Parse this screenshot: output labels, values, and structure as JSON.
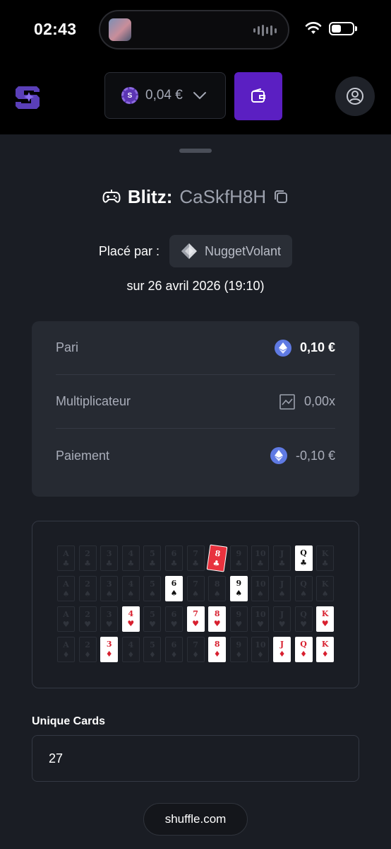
{
  "status_bar": {
    "time": "02:43",
    "battery_level": 0.45,
    "icons": [
      "now-playing-thumbnail",
      "audio-waveform-icon",
      "wifi-icon",
      "battery-icon"
    ]
  },
  "header": {
    "logo_icon": "shuffle-logo-icon",
    "balance": "0,04 €",
    "currency_icon": "shuffle-coin-icon",
    "wallet_icon": "wallet-icon",
    "profile_icon": "user-icon",
    "accent_color": "#5b1fc2"
  },
  "bet": {
    "game": "Blitz:",
    "game_icon": "gamepad-icon",
    "bet_id": "CaSkfH8H",
    "copy_icon": "copy-icon",
    "placed_by_label": "Placé par :",
    "user": "NuggetVolant",
    "user_icon": "diamond-rank-icon",
    "date": "sur 26 avril 2026 (19:10)"
  },
  "stats": [
    {
      "label": "Pari",
      "value": "0,10 €",
      "icon": "ethereum-icon"
    },
    {
      "label": "Multiplicateur",
      "value": "0,00x",
      "icon": "chart-icon"
    },
    {
      "label": "Paiement",
      "value": "-0,10 €",
      "icon": "ethereum-icon"
    }
  ],
  "card_grid": {
    "ranks": [
      "A",
      "2",
      "3",
      "4",
      "5",
      "6",
      "7",
      "8",
      "9",
      "10",
      "J",
      "Q",
      "K"
    ],
    "rows": [
      {
        "suit": "♣",
        "red": false,
        "shown": [
          "8",
          "Q"
        ],
        "highlight": "8"
      },
      {
        "suit": "♠",
        "red": false,
        "shown": [
          "6",
          "9"
        ],
        "highlight": ""
      },
      {
        "suit": "♥",
        "red": true,
        "shown": [
          "4",
          "7",
          "8",
          "K"
        ],
        "highlight": ""
      },
      {
        "suit": "♦",
        "red": true,
        "shown": [
          "3",
          "8",
          "J",
          "Q",
          "K"
        ],
        "highlight": ""
      }
    ]
  },
  "unique_cards": {
    "label": "Unique Cards",
    "value": "27"
  },
  "footer": {
    "site": "shuffle.com"
  }
}
